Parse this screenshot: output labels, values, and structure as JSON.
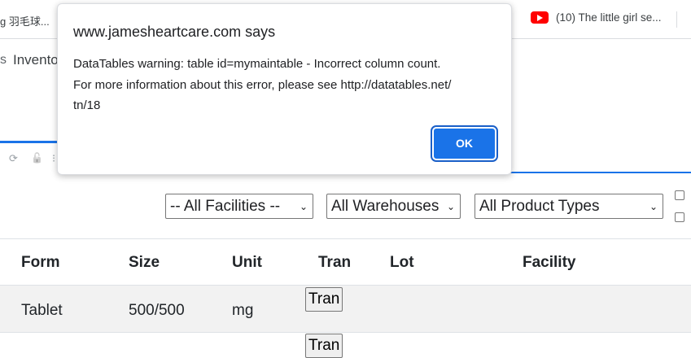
{
  "bookmarks": {
    "left_item": "g 羽毛球...",
    "dots": ".",
    "youtube_item": "(10) The little girl se..."
  },
  "header": {
    "mark": "s",
    "tab_label": "Invento"
  },
  "toolbar": {
    "refresh_glyph": "⟳",
    "unlock_glyph": "🔓",
    "partial_glyph": "⁝"
  },
  "filters": {
    "facility": "-- All Facilities --",
    "warehouse": "All Warehouses",
    "product_type": "All Product Types",
    "chevron": "⌄"
  },
  "table": {
    "columns": [
      "Form",
      "Size",
      "Unit",
      "Tran",
      "Lot",
      "Facility"
    ],
    "rows": [
      {
        "form": "Tablet",
        "size": "500/500",
        "unit": "mg",
        "tran_button": "Tran"
      },
      {
        "form": "",
        "size": "",
        "unit": "",
        "tran_button": "Tran"
      }
    ]
  },
  "dialog": {
    "title": "www.jamesheartcare.com says",
    "line1": "DataTables warning: table id=mymaintable - Incorrect column count.",
    "line2": "For more information about this error, please see http://datatables.net/",
    "line3": "tn/18",
    "ok_label": "OK"
  },
  "colors": {
    "accent": "#1a73e8",
    "youtube_red": "#ff0000",
    "row_stripe": "#f2f2f2"
  }
}
